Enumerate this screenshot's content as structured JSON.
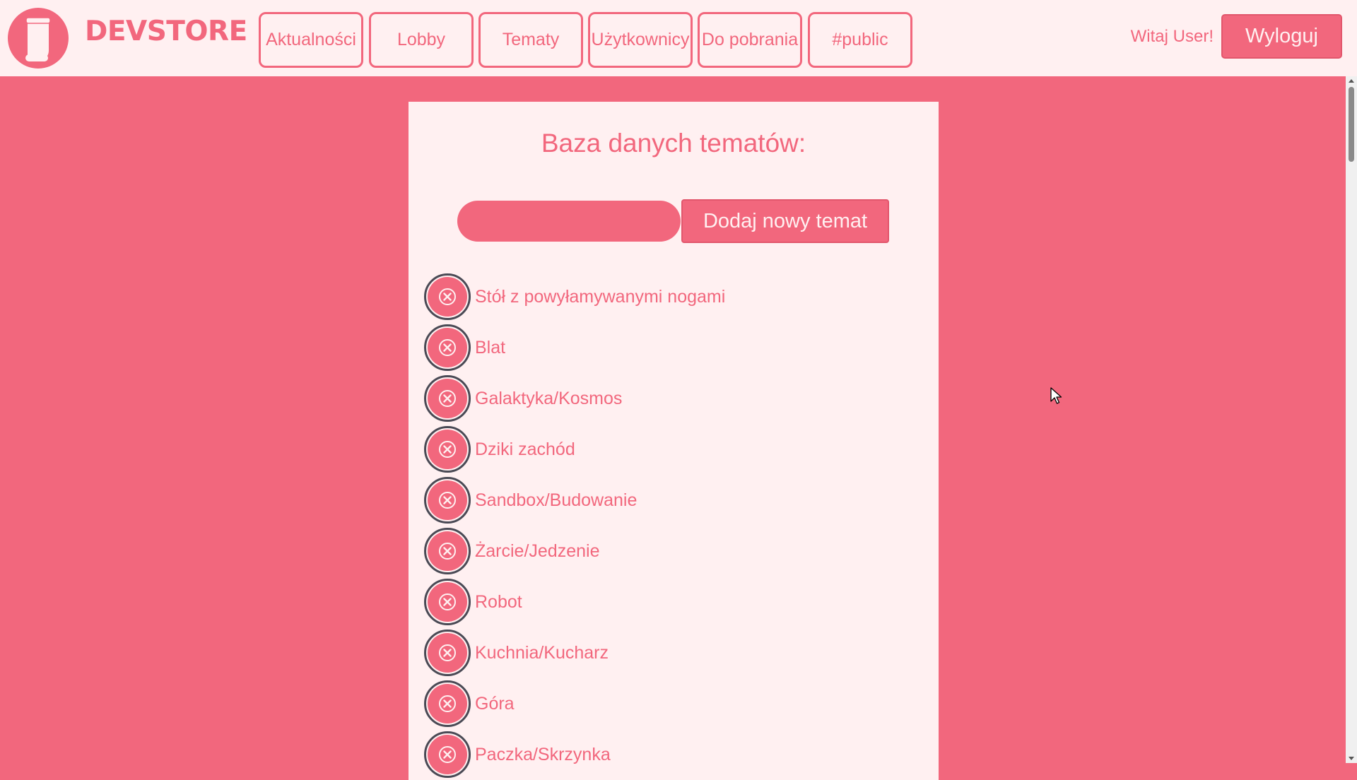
{
  "header": {
    "brand": "DEVSTORE",
    "logo_icon": "jar-icon",
    "nav": [
      {
        "label": "Aktualności"
      },
      {
        "label": "Lobby"
      },
      {
        "label": "Tematy"
      },
      {
        "label": "Użytkownicy"
      },
      {
        "label": "Do pobrania"
      },
      {
        "label": "#public"
      }
    ],
    "greeting": "Witaj User!",
    "logout_label": "Wyloguj"
  },
  "main": {
    "title": "Baza danych tematów:",
    "input_value": "",
    "add_label": "Dodaj nowy temat",
    "delete_icon": "close-icon",
    "topics": [
      {
        "name": "Stół z powyłamywanymi nogami"
      },
      {
        "name": "Blat"
      },
      {
        "name": "Galaktyka/Kosmos"
      },
      {
        "name": "Dziki zachód"
      },
      {
        "name": "Sandbox/Budowanie"
      },
      {
        "name": "Żarcie/Jedzenie"
      },
      {
        "name": "Robot"
      },
      {
        "name": "Kuchnia/Kucharz"
      },
      {
        "name": "Góra"
      },
      {
        "name": "Paczka/Skrzynka"
      }
    ]
  },
  "colors": {
    "accent": "#f2677d",
    "surface": "#fff0f1",
    "ring": "#4a4a55"
  }
}
